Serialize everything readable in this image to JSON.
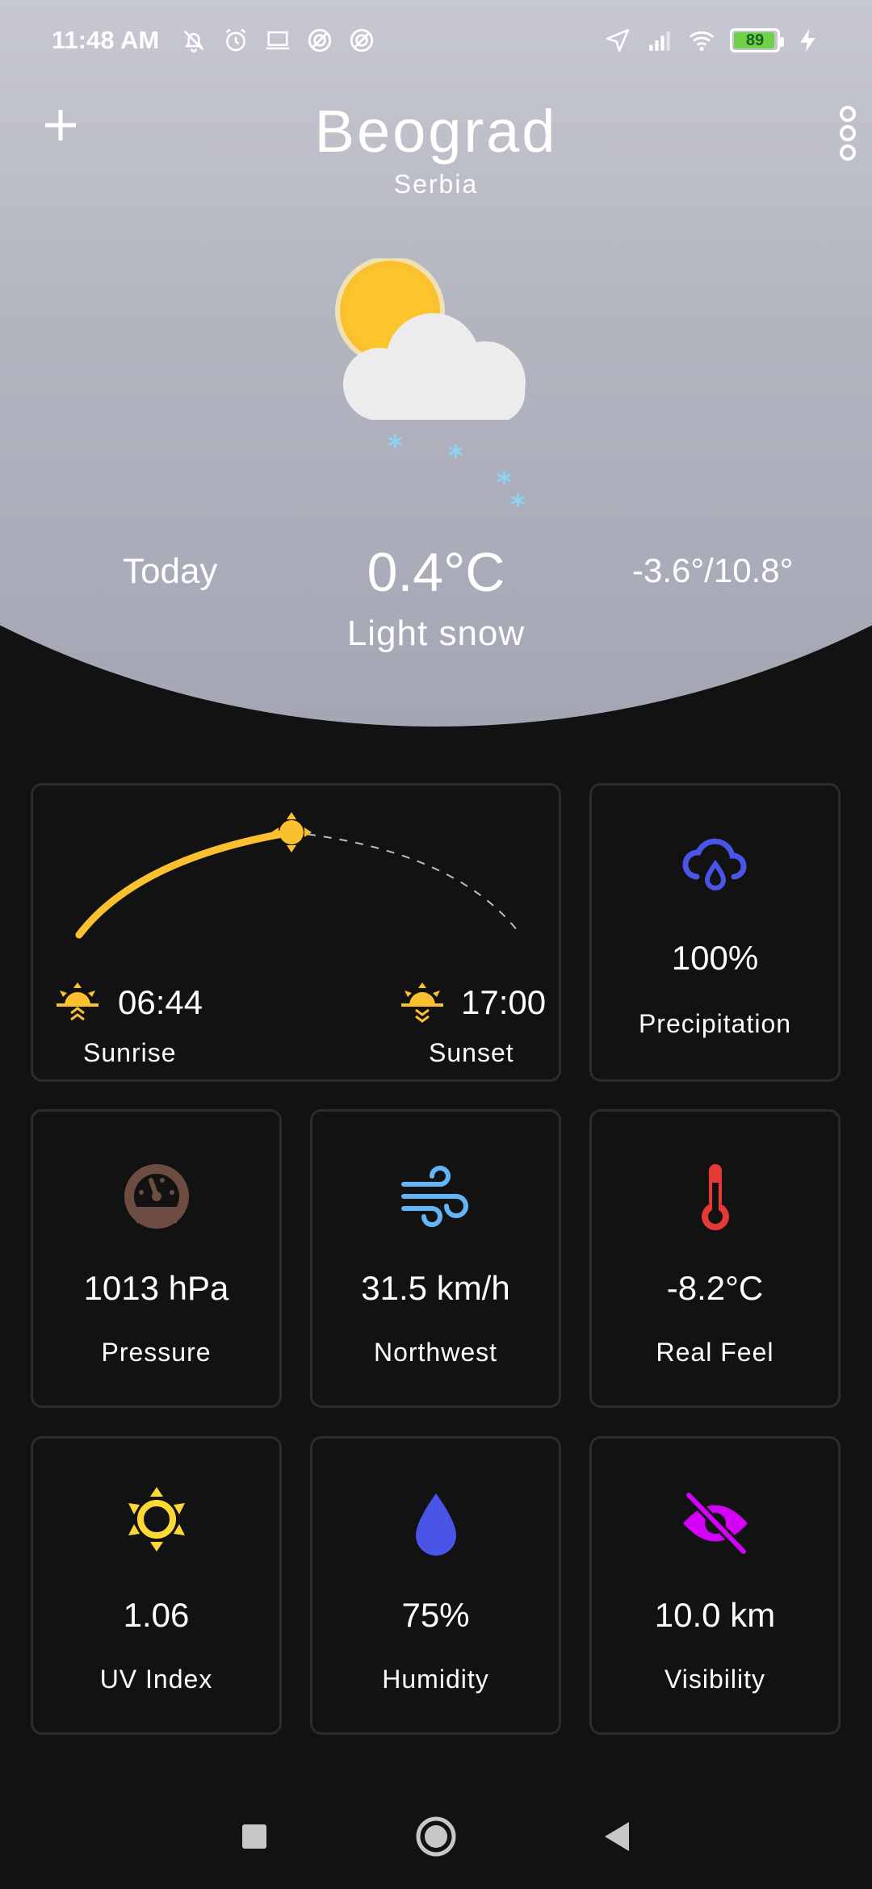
{
  "status_bar": {
    "time": "11:48 AM",
    "battery": "89",
    "icons_left": [
      "mute-icon",
      "alarm-icon",
      "laptop-icon",
      "notification-icon",
      "notification-icon"
    ],
    "icons_right": [
      "location-icon",
      "signal-icon",
      "wifi-icon",
      "battery-icon",
      "charging-icon"
    ]
  },
  "header": {
    "city": "Beograd",
    "country": "Serbia",
    "day_label": "Today",
    "temperature": "0.4°C",
    "condition": "Light snow",
    "min_max": "-3.6°/10.8°",
    "weather_icon": "partly-cloudy-snow-icon"
  },
  "sun": {
    "sunrise_time": "06:44",
    "sunrise_label": "Sunrise",
    "sunset_time": "17:00",
    "sunset_label": "Sunset"
  },
  "cards": {
    "precipitation": {
      "value": "100%",
      "label": "Precipitation",
      "icon": "rain-cloud-icon",
      "color": "#4a55e8"
    },
    "pressure": {
      "value": "1013 hPa",
      "label": "Pressure",
      "icon": "gauge-icon",
      "color": "#6d4c41"
    },
    "wind": {
      "value": "31.5 km/h",
      "label": "Northwest",
      "icon": "wind-icon",
      "color": "#64b5f6"
    },
    "real_feel": {
      "value": "-8.2°C",
      "label": "Real Feel",
      "icon": "thermometer-icon",
      "color": "#e53935"
    },
    "uv": {
      "value": "1.06",
      "label": "UV Index",
      "icon": "sun-icon",
      "color": "#fdd835"
    },
    "humidity": {
      "value": "75%",
      "label": "Humidity",
      "icon": "drop-icon",
      "color": "#4a55e8"
    },
    "visibility": {
      "value": "10.0 km",
      "label": "Visibility",
      "icon": "eye-off-icon",
      "color": "#d500f9"
    }
  },
  "colors": {
    "accent_sun": "#fbc02d",
    "background": "#121212",
    "card_border": "#2c2c2c"
  }
}
